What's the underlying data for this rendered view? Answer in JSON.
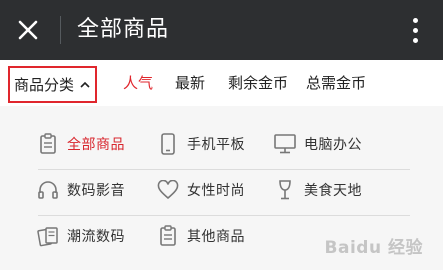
{
  "header": {
    "title": "全部商品"
  },
  "filter_bar": {
    "category_label": "商品分类",
    "tabs": [
      {
        "label": "人气",
        "active": true
      },
      {
        "label": "最新",
        "active": false
      },
      {
        "label": "剩余金币",
        "active": false
      },
      {
        "label": "总需金币",
        "active": false
      }
    ]
  },
  "categories": [
    {
      "label": "全部商品",
      "icon": "clipboard-icon",
      "active": true
    },
    {
      "label": "手机平板",
      "icon": "phone-icon",
      "active": false
    },
    {
      "label": "电脑办公",
      "icon": "monitor-icon",
      "active": false
    },
    {
      "label": "数码影音",
      "icon": "headphones-icon",
      "active": false
    },
    {
      "label": "女性时尚",
      "icon": "heart-icon",
      "active": false
    },
    {
      "label": "美食天地",
      "icon": "wine-glass-icon",
      "active": false
    },
    {
      "label": "潮流数码",
      "icon": "gadgets-icon",
      "active": false
    },
    {
      "label": "其他商品",
      "icon": "clipboard-icon",
      "active": false
    }
  ],
  "watermark": "Baidu 经验",
  "colors": {
    "accent": "#e0262d",
    "header_bg": "#2d2f31",
    "panel_bg": "#f6f6f6"
  }
}
